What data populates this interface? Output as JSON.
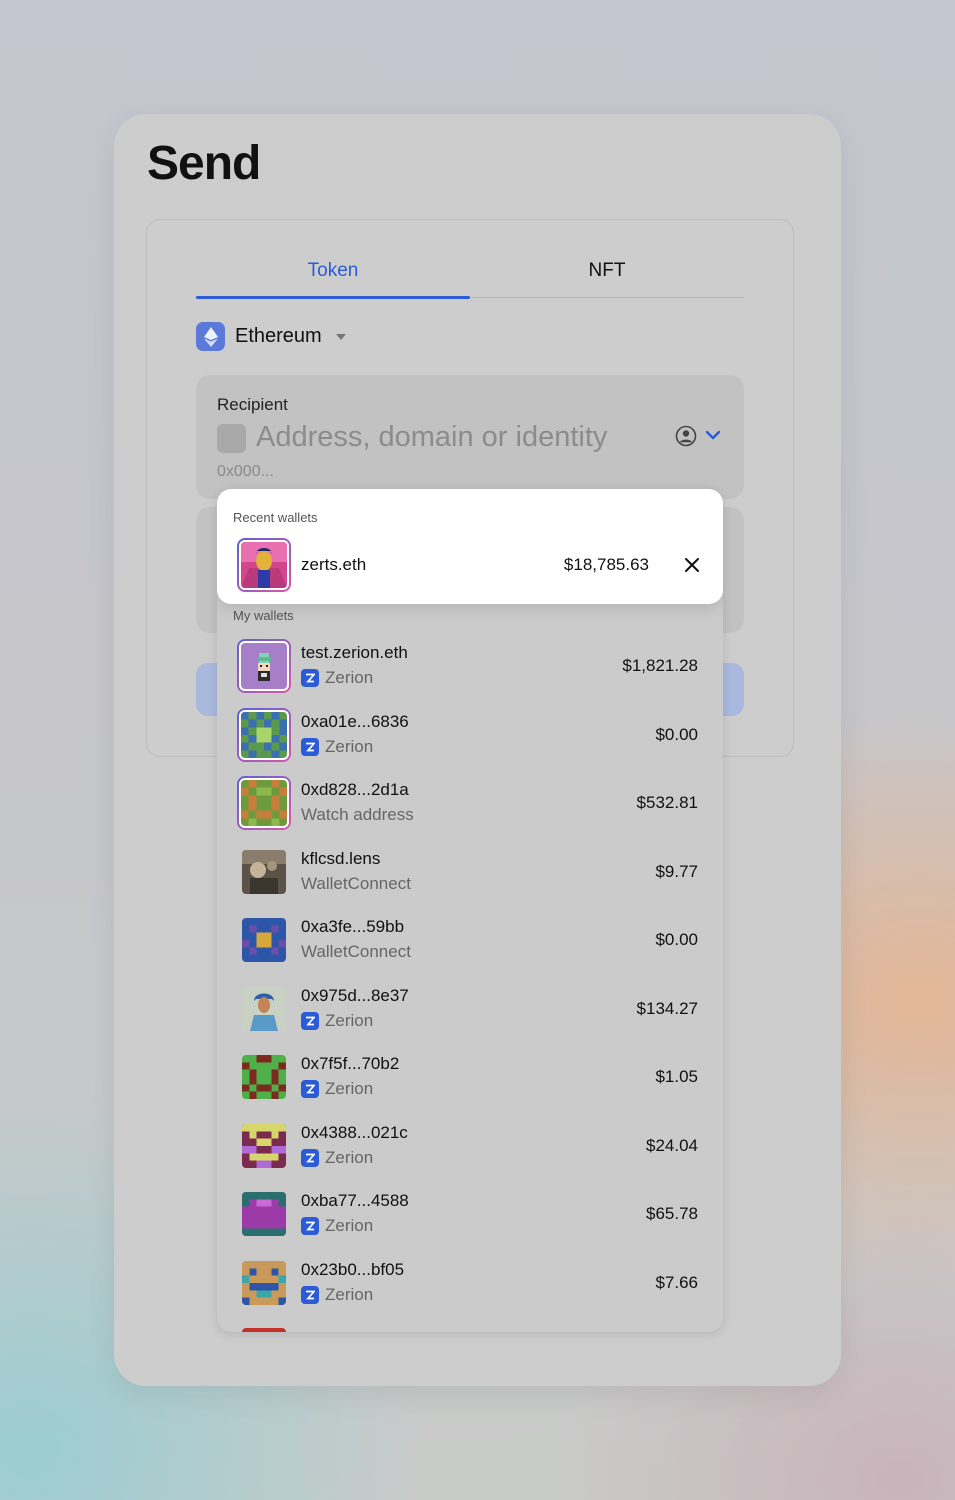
{
  "page": {
    "title": "Send"
  },
  "tabs": [
    {
      "label": "Token"
    },
    {
      "label": "NFT"
    }
  ],
  "network": {
    "label": "Ethereum"
  },
  "recipient": {
    "label": "Recipient",
    "placeholder": "Address, domain or identity",
    "hint": "0x000..."
  },
  "dropdown": {
    "recent_label": "Recent wallets",
    "my_label": "My wallets",
    "recent": [
      {
        "name": "zerts.eth",
        "value": "$18,785.63"
      }
    ],
    "wallets": [
      {
        "name": "test.zerion.eth",
        "source": "Zerion",
        "value": "$1,821.28"
      },
      {
        "name": "0xa01e...6836",
        "source": "Zerion",
        "value": "$0.00"
      },
      {
        "name": "0xd828...2d1a",
        "source": "Watch address",
        "value": "$532.81"
      },
      {
        "name": "kflcsd.lens",
        "source": "WalletConnect",
        "value": "$9.77"
      },
      {
        "name": "0xa3fe...59bb",
        "source": "WalletConnect",
        "value": "$0.00"
      },
      {
        "name": "0x975d...8e37",
        "source": "Zerion",
        "value": "$134.27"
      },
      {
        "name": "0x7f5f...70b2",
        "source": "Zerion",
        "value": "$1.05"
      },
      {
        "name": "0x4388...021c",
        "source": "Zerion",
        "value": "$24.04"
      },
      {
        "name": "0xba77...4588",
        "source": "Zerion",
        "value": "$65.78"
      },
      {
        "name": "0x23b0...bf05",
        "source": "Zerion",
        "value": "$7.66"
      }
    ]
  },
  "colors": {
    "accent": "#2b5bd7",
    "ethereum": "#5b79d8",
    "zerion": "#2b5bd7"
  }
}
